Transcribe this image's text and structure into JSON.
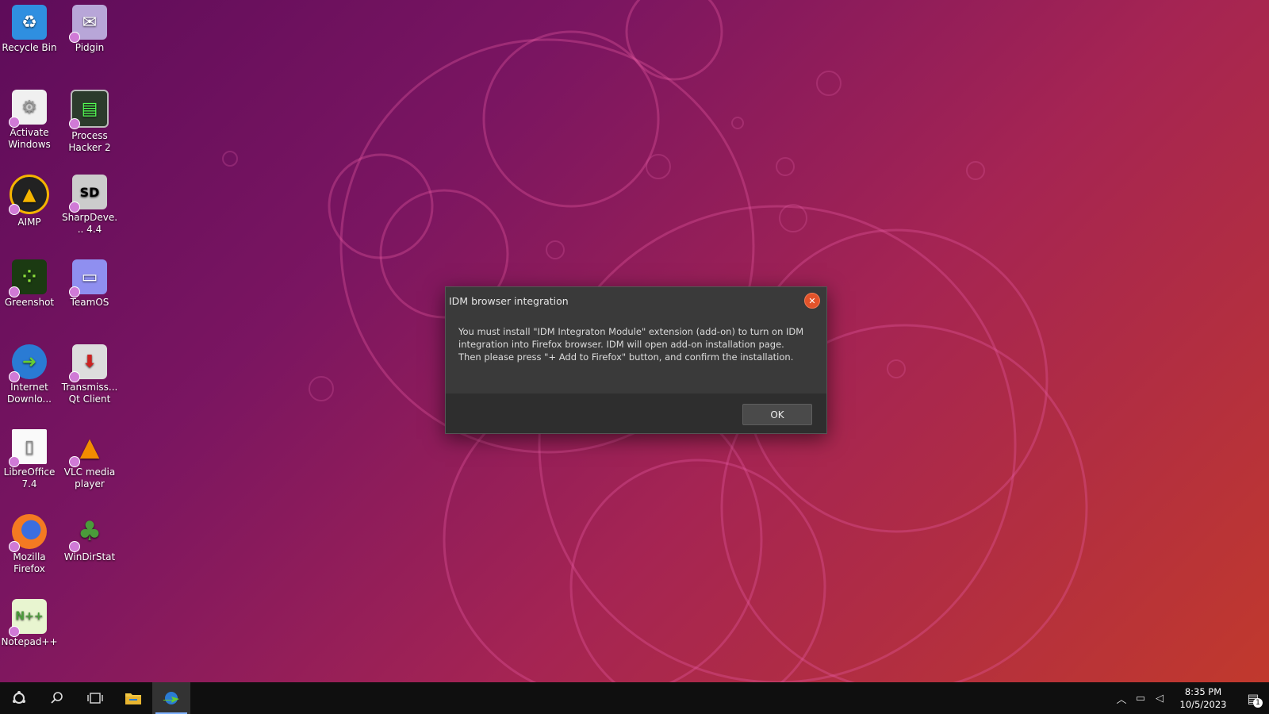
{
  "desktop": {
    "icons": [
      {
        "label": "Recycle Bin",
        "icon": "recycle-bin-icon"
      },
      {
        "label": "Pidgin",
        "icon": "pidgin-icon"
      },
      {
        "label": "Activate Windows",
        "icon": "activate-windows-icon"
      },
      {
        "label": "Process Hacker 2",
        "icon": "process-hacker-icon"
      },
      {
        "label": "AIMP",
        "icon": "aimp-icon"
      },
      {
        "label": "SharpDeve... 4.4",
        "icon": "sharpdevelop-icon"
      },
      {
        "label": "Greenshot",
        "icon": "greenshot-icon"
      },
      {
        "label": "TeamOS",
        "icon": "teamos-icon"
      },
      {
        "label": "Internet Downlo...",
        "icon": "internet-download-manager-icon"
      },
      {
        "label": "Transmiss... Qt Client",
        "icon": "transmission-icon"
      },
      {
        "label": "LibreOffice 7.4",
        "icon": "libreoffice-icon"
      },
      {
        "label": "VLC media player",
        "icon": "vlc-icon"
      },
      {
        "label": "Mozilla Firefox",
        "icon": "firefox-icon"
      },
      {
        "label": "WinDirStat",
        "icon": "windirstat-icon"
      },
      {
        "label": "Notepad++",
        "icon": "notepadpp-icon"
      }
    ]
  },
  "dialog": {
    "title": "IDM browser integration",
    "message_line1": "You must install \"IDM Integraton Module\" extension (add-on) to turn on IDM",
    "message_line2": "integration into Firefox browser. IDM will open add-on installation page.",
    "message_line3": "Then please press \"+ Add to Firefox\" button, and confirm the installation.",
    "ok_label": "OK",
    "close_glyph": "✕"
  },
  "taskbar": {
    "start_icon": "ubuntu-start-icon",
    "search_icon": "search-icon",
    "task_view_icon": "task-view-icon",
    "file_explorer_icon": "folder-icon",
    "idm_icon": "internet-download-manager-icon",
    "time": "8:35 PM",
    "date": "10/5/2023",
    "notification_count": "1"
  },
  "colors": {
    "accent": "#7fb2ff",
    "dialog_bg": "#3a3a3a",
    "close_red": "#e2532a"
  }
}
